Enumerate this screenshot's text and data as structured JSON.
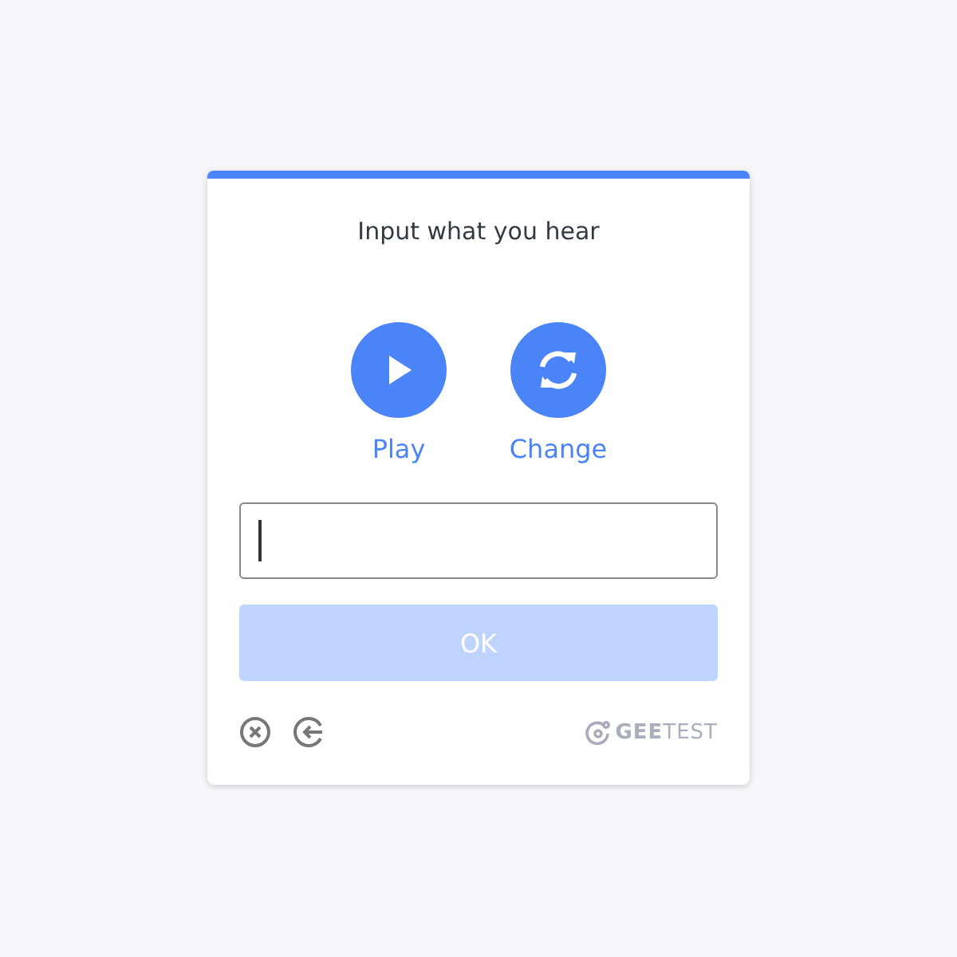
{
  "title": "Input what you hear",
  "actions": [
    {
      "kind": "play",
      "label": "Play"
    },
    {
      "kind": "change",
      "label": "Change"
    }
  ],
  "answer": {
    "focused": true
  },
  "ok_button": {
    "label": "OK",
    "disabled": true
  },
  "brand": "**GEE**TEST"
}
